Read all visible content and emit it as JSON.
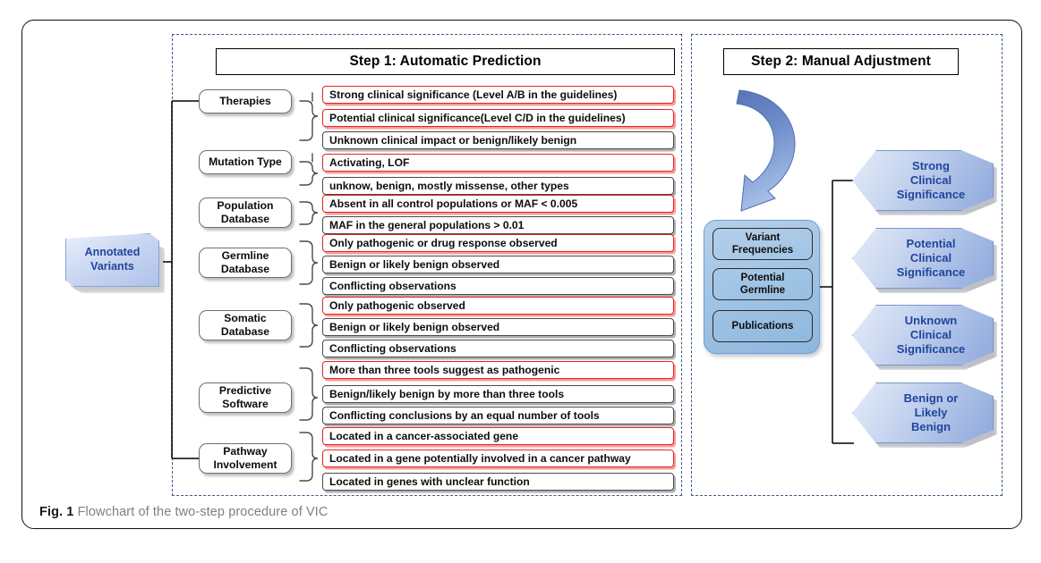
{
  "figure": {
    "caption_label": "Fig. 1",
    "caption_text": " Flowchart of the two-step procedure of VIC"
  },
  "colors": {
    "selected_border": "#e8231f",
    "selected_shadow": "#f79696",
    "unselected_border": "#4a4a4a",
    "panel_dash": "#3e5a86",
    "blue_text": "#21459c",
    "step2_container": "#9dc2e4"
  },
  "input_node": {
    "line1": "Annotated",
    "line2": "Variants"
  },
  "step1": {
    "header": "Step 1: Automatic Prediction",
    "categories": [
      {
        "line1": "Therapies",
        "line2": ""
      },
      {
        "line1": "Mutation Type",
        "line2": ""
      },
      {
        "line1": "Population",
        "line2": "Database"
      },
      {
        "line1": "Germline",
        "line2": "Database"
      },
      {
        "line1": "Somatic",
        "line2": "Database"
      },
      {
        "line1": "Predictive",
        "line2": "Software"
      },
      {
        "line1": "Pathway",
        "line2": "Involvement"
      }
    ],
    "options": [
      {
        "text": "Strong clinical significance (Level A/B in the guidelines)",
        "selected": true
      },
      {
        "text": "Potential clinical significance(Level C/D in the guidelines)",
        "selected": true
      },
      {
        "text": "Unknown clinical impact or benign/likely benign",
        "selected": false
      },
      {
        "text": "Activating, LOF",
        "selected": true
      },
      {
        "text": "unknow, benign, mostly missense, other types",
        "selected": false
      },
      {
        "text": "Absent in all control populations or MAF < 0.005",
        "selected": true
      },
      {
        "text": "MAF in the general populations > 0.01",
        "selected": false
      },
      {
        "text": "Only pathogenic or drug response observed",
        "selected": true
      },
      {
        "text": "Benign or likely benign observed",
        "selected": false
      },
      {
        "text": "Conflicting observations",
        "selected": false
      },
      {
        "text": "Only pathogenic observed",
        "selected": true
      },
      {
        "text": "Benign or likely benign observed",
        "selected": false
      },
      {
        "text": "Conflicting observations",
        "selected": false
      },
      {
        "text": "More than three tools suggest as pathogenic",
        "selected": true
      },
      {
        "text": "Benign/likely benign by more than three tools",
        "selected": false
      },
      {
        "text": "Conflicting conclusions by an equal number of tools",
        "selected": false
      },
      {
        "text": "Located in a cancer-associated gene",
        "selected": true
      },
      {
        "text": "Located in a gene potentially involved in a cancer pathway",
        "selected": true
      },
      {
        "text": "Located in genes with unclear function",
        "selected": false
      }
    ]
  },
  "step2": {
    "header": "Step 2: Manual Adjustment",
    "evidence_items": [
      {
        "line1": "Variant",
        "line2": "Frequencies"
      },
      {
        "line1": "Potential",
        "line2": "Germline"
      },
      {
        "line1": "Publications",
        "line2": ""
      }
    ],
    "results": [
      {
        "line1": "Strong",
        "line2": "Clinical",
        "line3": "Significance"
      },
      {
        "line1": "Potential",
        "line2": "Clinical",
        "line3": "Significance"
      },
      {
        "line1": "Unknown",
        "line2": "Clinical",
        "line3": "Significance"
      },
      {
        "line1": "Benign or",
        "line2": "Likely",
        "line3": "Benign"
      }
    ]
  }
}
